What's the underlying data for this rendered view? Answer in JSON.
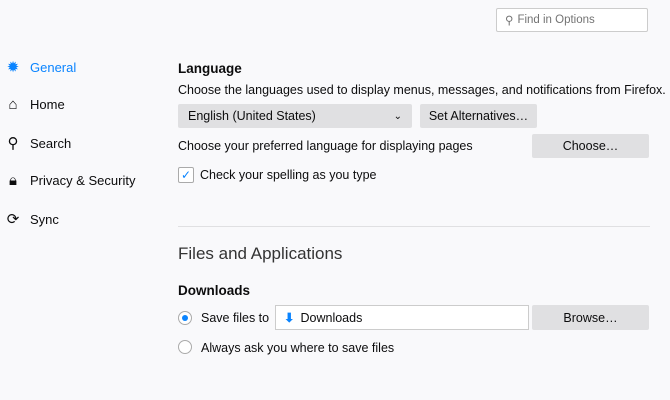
{
  "search": {
    "placeholder": "Find in Options"
  },
  "sidebar": {
    "items": [
      {
        "label": "General",
        "icon": "gear-icon"
      },
      {
        "label": "Home",
        "icon": "home-icon"
      },
      {
        "label": "Search",
        "icon": "search-icon"
      },
      {
        "label": "Privacy & Security",
        "icon": "lock-icon"
      },
      {
        "label": "Sync",
        "icon": "sync-icon"
      }
    ]
  },
  "language": {
    "heading": "Language",
    "description": "Choose the languages used to display menus, messages, and notifications from Firefox.",
    "selected": "English (United States)",
    "set_alternatives": "Set Alternatives…",
    "pages_label": "Choose your preferred language for displaying pages",
    "choose": "Choose…",
    "spellcheck": "Check your spelling as you type",
    "spellcheck_checked": true
  },
  "files": {
    "heading": "Files and Applications",
    "downloads_heading": "Downloads",
    "save_to_label": "Save files to",
    "folder": "Downloads",
    "browse": "Browse…",
    "always_ask": "Always ask you where to save files",
    "selected_option": "save"
  },
  "colors": {
    "accent": "#0a84ff"
  }
}
